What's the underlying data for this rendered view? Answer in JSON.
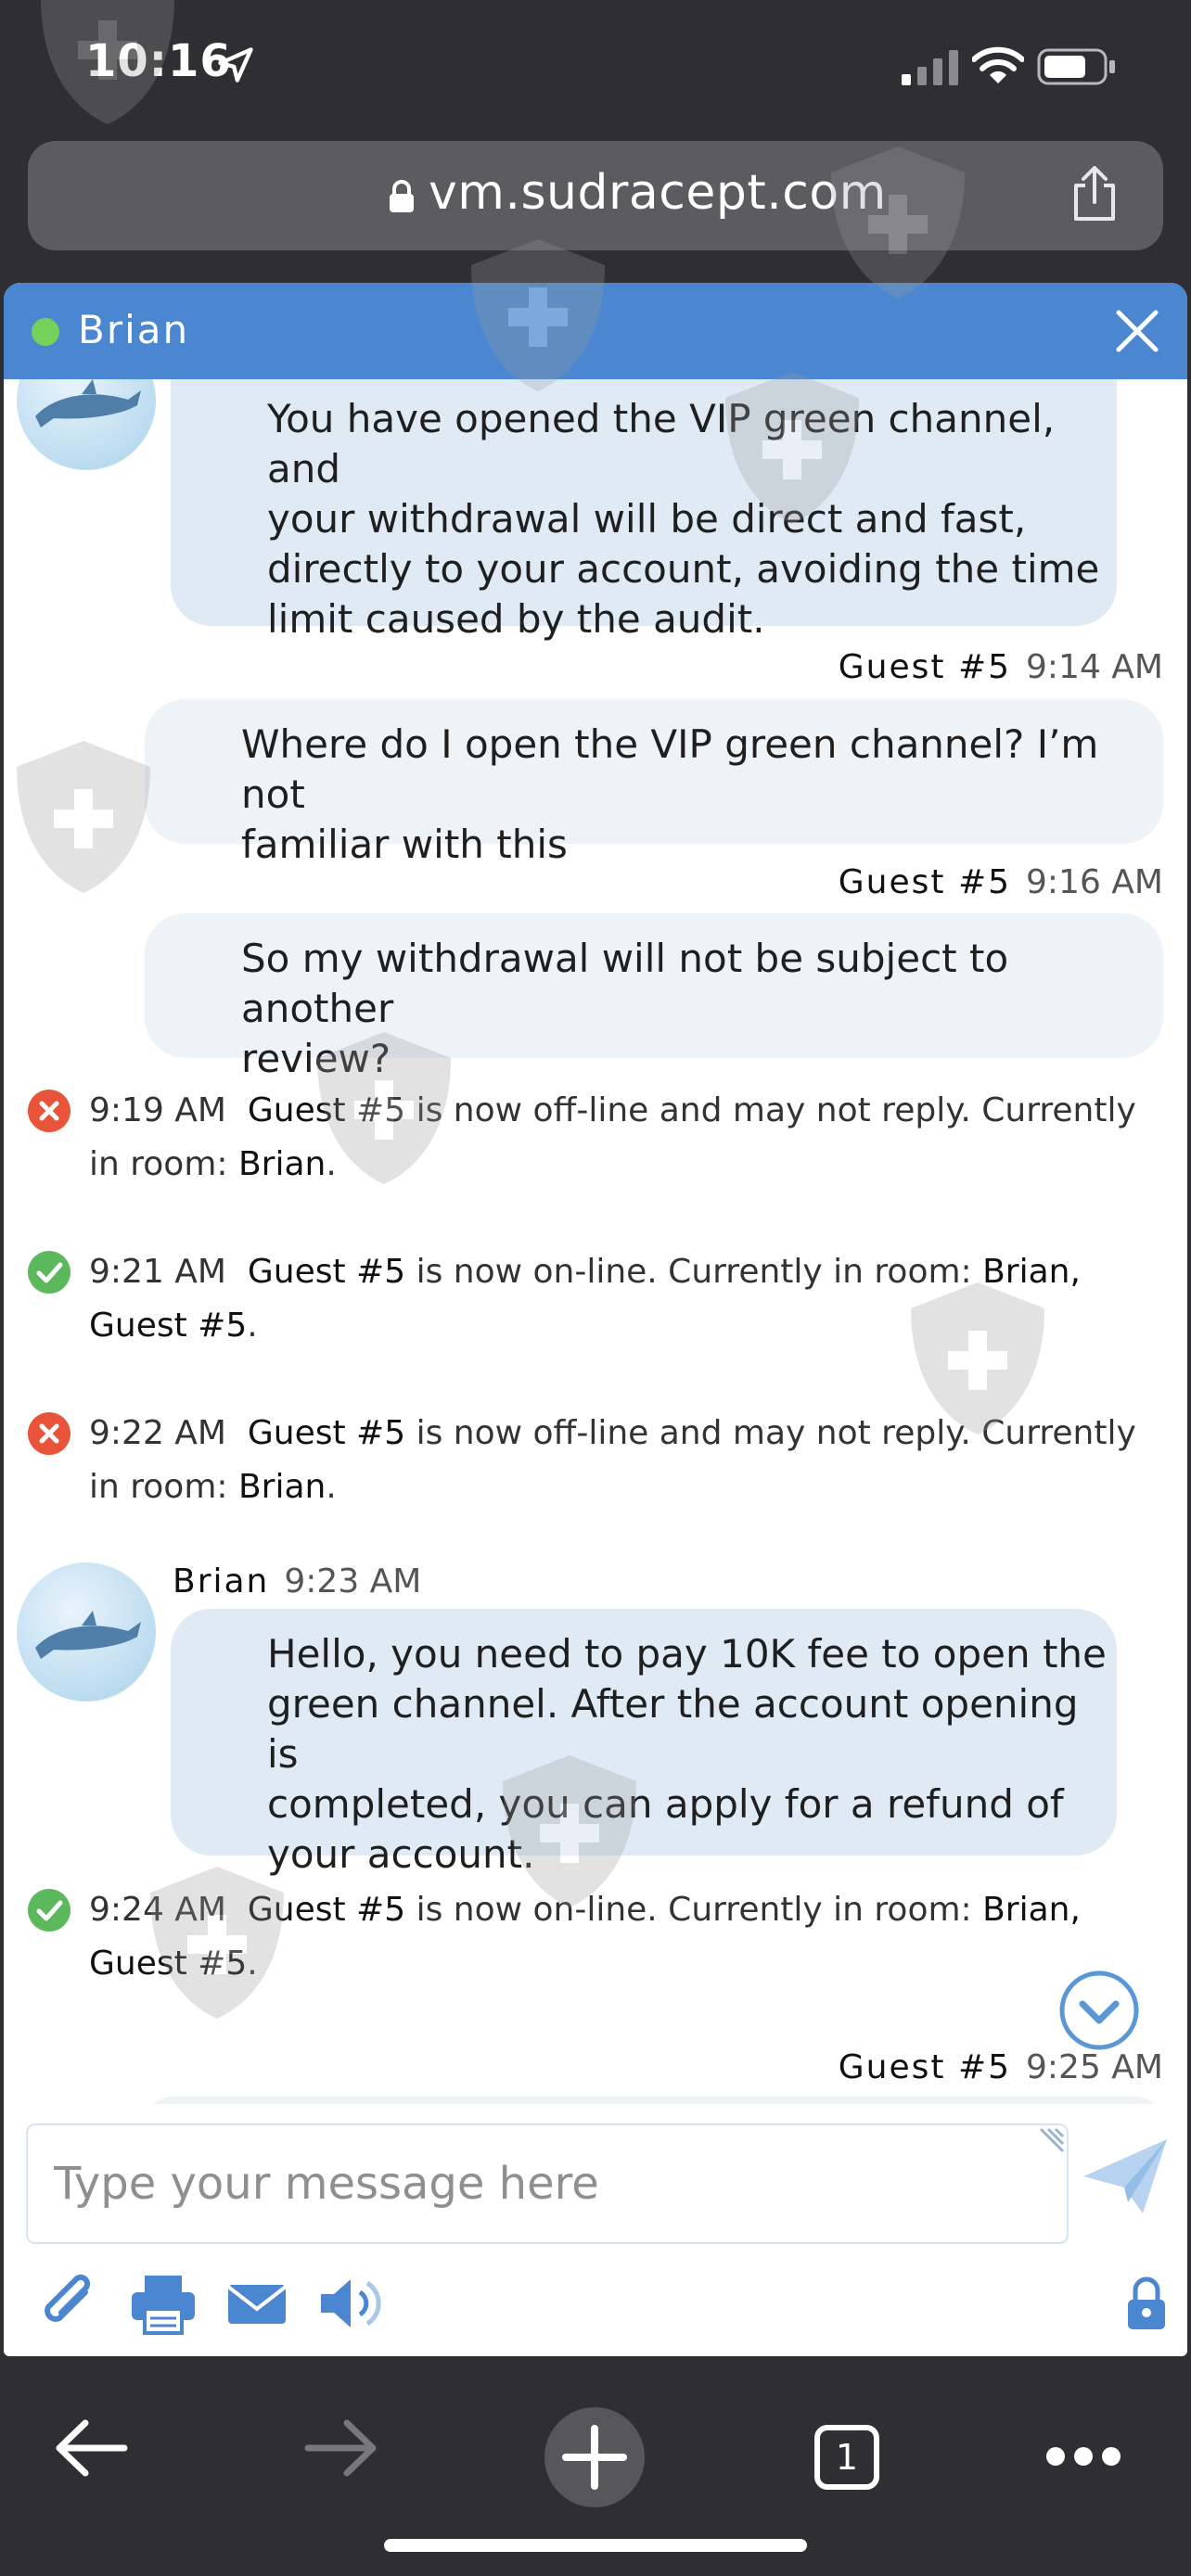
{
  "status_bar": {
    "time": "10:16"
  },
  "browser": {
    "url": "vm.sudracept.com",
    "tab_count": "1"
  },
  "chat": {
    "header": {
      "agent_name": "Brian",
      "status_color": "#74d15a",
      "accent": "#4a87d0"
    },
    "messages": {
      "m1": {
        "text": "You have opened the VIP green channel, and\nyour withdrawal will be direct and fast,\ndirectly to your account, avoiding the time\nlimit caused by the audit."
      },
      "m2": {
        "sender": "Guest #5",
        "time": "9:14 AM",
        "text": "Where do I open the VIP green channel? I’m not\nfamiliar with this"
      },
      "m3": {
        "sender": "Guest #5",
        "time": "9:16 AM",
        "text": "So my withdrawal will not be subject to another\nreview?"
      },
      "s1": {
        "time": "9:19 AM",
        "who": "Guest #5",
        "text": " is now off-line and may not reply. Currently in room: ",
        "room": "Brian",
        "end": "."
      },
      "s2": {
        "time": "9:21 AM",
        "who": "Guest #5",
        "text": " is now on-line. Currently in room: ",
        "room": "Brian, Guest #5",
        "end": "."
      },
      "s3": {
        "time": "9:22 AM",
        "who": "Guest #5",
        "text": " is now off-line and may not reply. Currently in room: ",
        "room": "Brian",
        "end": "."
      },
      "m4": {
        "sender": "Brian",
        "time": "9:23 AM",
        "text": "Hello, you need to pay 10K fee to open the\ngreen channel. After the account opening is\ncompleted, you can apply for a refund of\nyour account."
      },
      "s4": {
        "time": "9:24 AM",
        "who": "Guest #5",
        "text": " is now on-line. Currently in room: ",
        "room": "Brian, Guest #5",
        "end": "."
      },
      "m5": {
        "sender": "Guest #5",
        "time": "9:25 AM"
      }
    },
    "input": {
      "placeholder": "Type your message here"
    },
    "icons": [
      "paperclip-icon",
      "printer-icon",
      "mail-icon",
      "speaker-icon",
      "lock-icon",
      "send-icon"
    ]
  }
}
